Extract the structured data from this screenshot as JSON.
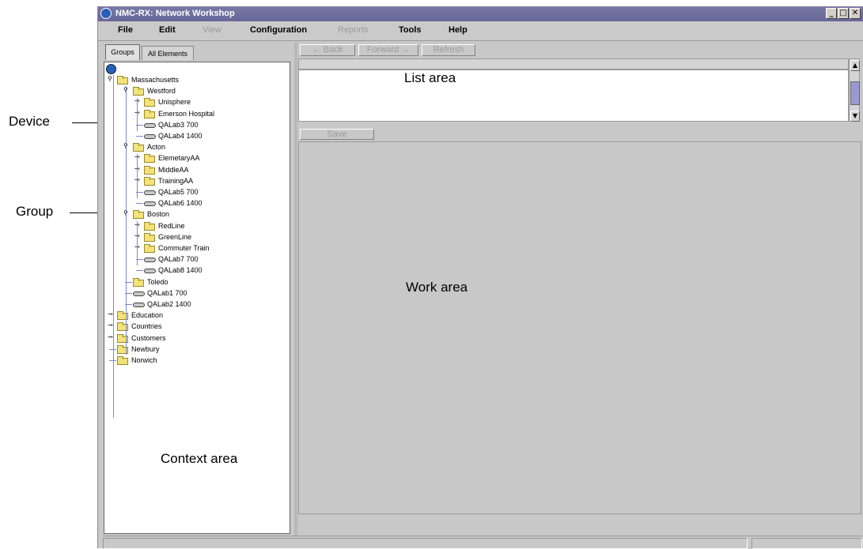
{
  "annotations": {
    "device": "Device",
    "group": "Group"
  },
  "window": {
    "title": "NMC-RX: Network Workshop",
    "controls": [
      "_",
      "□",
      "✕"
    ]
  },
  "menubar": {
    "file": "File",
    "edit": "Edit",
    "view": "View",
    "configuration": "Configuration",
    "reports": "Reports",
    "tools": "Tools",
    "help": "Help"
  },
  "tabs": {
    "groups": "Groups",
    "all_elements": "All Elements"
  },
  "tree": [
    {
      "label": "Massachusetts",
      "type": "group",
      "level": 0,
      "expanded": true
    },
    {
      "label": "Westford",
      "type": "group",
      "level": 1,
      "expanded": true
    },
    {
      "label": "Unisphere",
      "type": "group",
      "level": 2,
      "expanded": false
    },
    {
      "label": "Emerson Hospital",
      "type": "group",
      "level": 2,
      "expanded": false
    },
    {
      "label": "QALab3 700",
      "type": "device",
      "level": 2
    },
    {
      "label": "QALab4 1400",
      "type": "device",
      "level": 2
    },
    {
      "label": "Acton",
      "type": "group",
      "level": 1,
      "expanded": true
    },
    {
      "label": "ElemetaryAA",
      "type": "group",
      "level": 2,
      "expanded": false
    },
    {
      "label": "MiddleAA",
      "type": "group",
      "level": 2,
      "expanded": false
    },
    {
      "label": "TrainingAA",
      "type": "group",
      "level": 2,
      "expanded": false
    },
    {
      "label": "QALab5 700",
      "type": "device",
      "level": 2
    },
    {
      "label": "QALab6 1400",
      "type": "device",
      "level": 2
    },
    {
      "label": "Boston",
      "type": "group",
      "level": 1,
      "expanded": true
    },
    {
      "label": "RedLine",
      "type": "group",
      "level": 2,
      "expanded": false
    },
    {
      "label": "GreenLine",
      "type": "group",
      "level": 2,
      "expanded": false
    },
    {
      "label": "Commuter Train",
      "type": "group",
      "level": 2,
      "expanded": false
    },
    {
      "label": "QALab7 700",
      "type": "device",
      "level": 2
    },
    {
      "label": "QALab8 1400",
      "type": "device",
      "level": 2
    },
    {
      "label": "Toledo",
      "type": "group",
      "level": 1,
      "leaf": true
    },
    {
      "label": "QALab1 700",
      "type": "device",
      "level": 1
    },
    {
      "label": "QALab2 1400",
      "type": "device",
      "level": 1
    },
    {
      "label": "Education",
      "type": "group",
      "level": 0,
      "expanded": false
    },
    {
      "label": "Countries",
      "type": "group",
      "level": 0,
      "expanded": false
    },
    {
      "label": "Customers",
      "type": "group",
      "level": 0,
      "expanded": false
    },
    {
      "label": "Newbury",
      "type": "group",
      "level": 0,
      "leaf": true
    },
    {
      "label": "Norwich",
      "type": "group",
      "level": 0,
      "leaf": true
    }
  ],
  "context_area_label": "Context area",
  "nav": {
    "back": "← Back",
    "forward": "Forward →",
    "refresh": "Refresh"
  },
  "list_area_label": "List area",
  "save_label": "Save",
  "work_area_label": "Work area",
  "colors": {
    "title_bar": "#6f6fa0",
    "folder": "#f3e27a",
    "tree_line": "#7a8ad0"
  }
}
